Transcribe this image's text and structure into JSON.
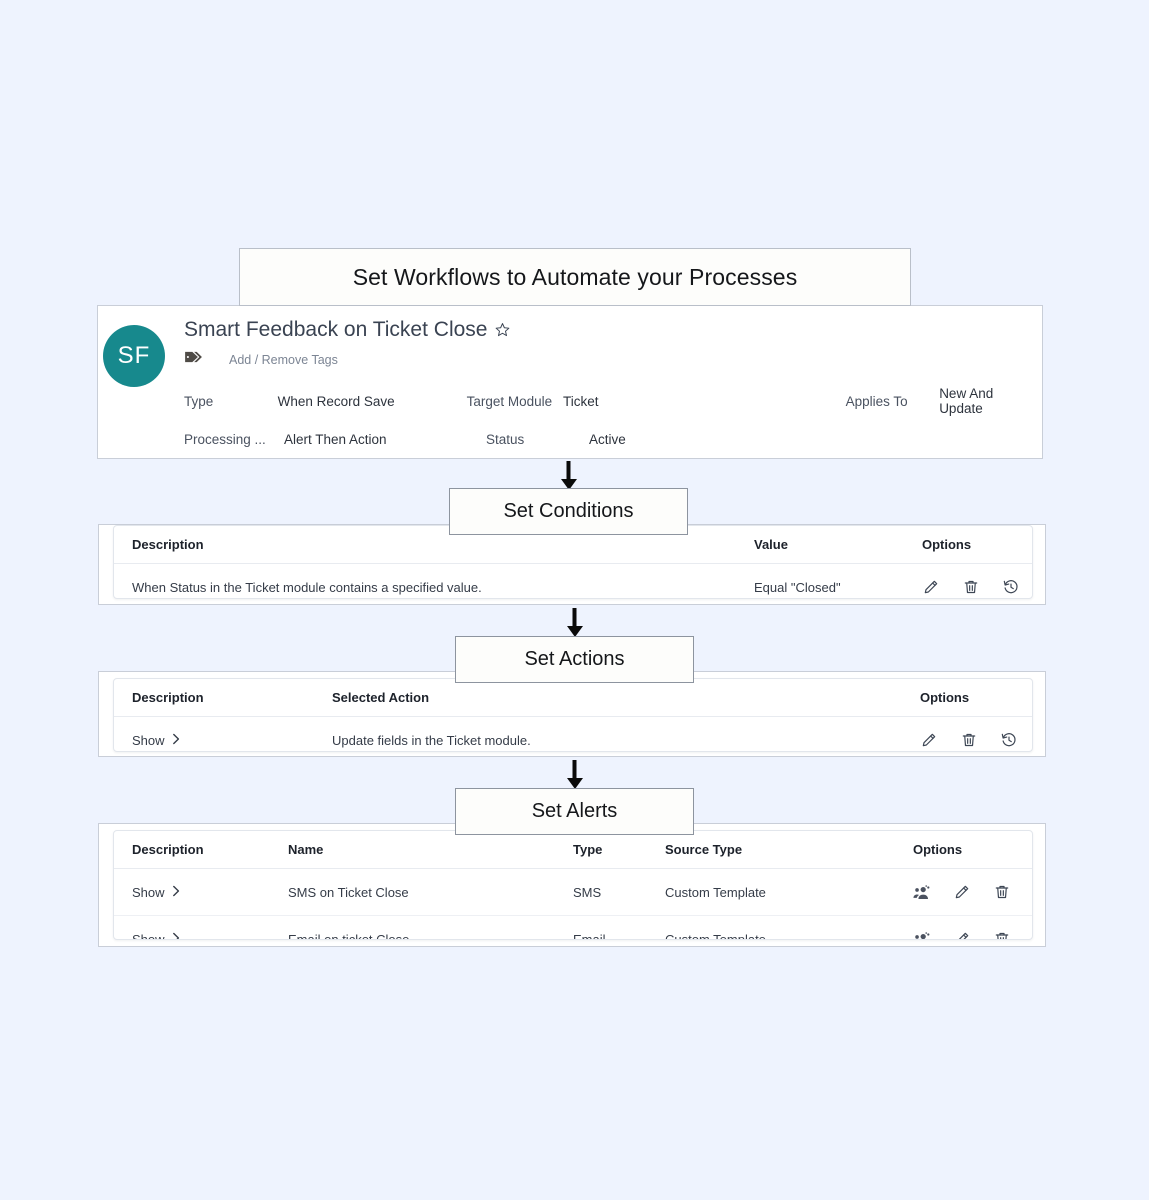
{
  "banner": {
    "title": "Set Workflows to Automate your Processes"
  },
  "workflow": {
    "avatar_initials": "SF",
    "name": "Smart Feedback on Ticket Close",
    "favorite_icon": "star-outline-icon",
    "tag_icon": "tag-icon",
    "tags_label": "Add / Remove Tags",
    "meta": [
      {
        "label": "Type",
        "value": "When Record Save",
        "label2": "Target Module",
        "value2": "Ticket",
        "label3": "Applies To",
        "value3": "New And Update"
      },
      {
        "label": "Processing ...",
        "value": "Alert Then Action",
        "label2": "Status",
        "value2": "Active",
        "label3": "",
        "value3": ""
      }
    ],
    "labels": {
      "type": "Type",
      "type_value": "When Record Save",
      "target_module": "Target Module",
      "target_module_value": "Ticket",
      "applies_to": "Applies To",
      "applies_to_value": "New And Update",
      "processing": "Processing ...",
      "processing_value": "Alert Then Action",
      "status": "Status",
      "status_value": "Active"
    }
  },
  "sections": {
    "conditions": {
      "title": "Set Conditions",
      "columns": [
        "Description",
        "Value",
        "Options"
      ],
      "rows": [
        {
          "description": "When Status in the Ticket module contains a specified value.",
          "value": "Equal \"Closed\"",
          "options": [
            "edit-icon",
            "delete-icon",
            "history-icon"
          ]
        }
      ]
    },
    "actions": {
      "title": "Set Actions",
      "columns": [
        "Description",
        "Selected Action",
        "Options"
      ],
      "rows": [
        {
          "description": "Show",
          "selected_action": "Update fields in the Ticket module.",
          "options": [
            "edit-icon",
            "delete-icon",
            "history-icon"
          ]
        }
      ]
    },
    "alerts": {
      "title": "Set Alerts",
      "columns": [
        "Description",
        "Name",
        "Type",
        "Source Type",
        "Options"
      ],
      "rows": [
        {
          "description": "Show",
          "name": "SMS on Ticket Close",
          "type": "SMS",
          "source_type": "Custom Template",
          "options": [
            "recipients-icon",
            "edit-icon",
            "delete-icon"
          ]
        },
        {
          "description": "Show",
          "name": "Email on ticket Close",
          "type": "Email",
          "source_type": "Custom Template",
          "options": [
            "recipients-icon",
            "edit-icon",
            "delete-icon"
          ]
        }
      ]
    }
  },
  "colors": {
    "background": "#eef3fe",
    "avatar": "#17898d",
    "card": "#ffffff",
    "border": "#c9ced8",
    "text": "#353c48"
  }
}
